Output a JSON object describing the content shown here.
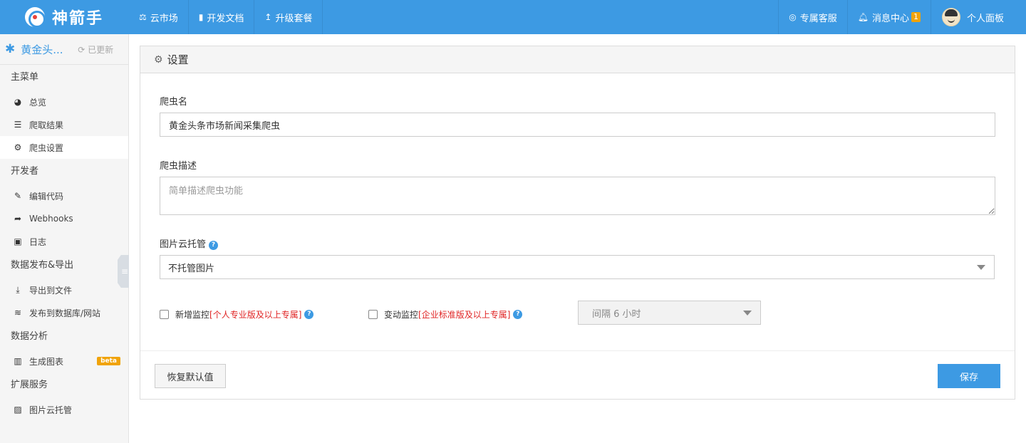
{
  "topbar": {
    "logo": "神箭手",
    "nav_left": [
      {
        "label": "云市场",
        "icon": "scale-icon"
      },
      {
        "label": "开发文档",
        "icon": "book-icon"
      },
      {
        "label": "升级套餐",
        "icon": "upgrade-arrow-icon"
      }
    ],
    "support": "专属客服",
    "messages": "消息中心",
    "messages_count": "1",
    "profile": "个人面板"
  },
  "sidebar": {
    "crawler_name": "黄金头...",
    "updated": "已更新",
    "sections": [
      {
        "title": "主菜单",
        "items": [
          {
            "label": "总览",
            "icon": "dashboard-icon"
          },
          {
            "label": "爬取结果",
            "icon": "list-icon"
          },
          {
            "label": "爬虫设置",
            "icon": "gear-icon"
          }
        ]
      },
      {
        "title": "开发者",
        "items": [
          {
            "label": "编辑代码",
            "icon": "edit-icon"
          },
          {
            "label": "Webhooks",
            "icon": "share-icon"
          },
          {
            "label": "日志",
            "icon": "calendar-icon"
          }
        ]
      },
      {
        "title": "数据发布&导出",
        "items": [
          {
            "label": "导出到文件",
            "icon": "download-icon"
          },
          {
            "label": "发布到数据库/网站",
            "icon": "database-icon"
          }
        ]
      },
      {
        "title": "数据分析",
        "items": [
          {
            "label": "生成图表",
            "icon": "bar-chart-icon",
            "badge": "beta"
          }
        ]
      },
      {
        "title": "扩展服务",
        "items": [
          {
            "label": "图片云托管",
            "icon": "image-icon"
          }
        ]
      }
    ]
  },
  "settings": {
    "title": "设置",
    "name_label": "爬虫名",
    "name_value": "黄金头条市场新闻采集爬虫",
    "desc_label": "爬虫描述",
    "desc_placeholder": "简单描述爬虫功能",
    "image_label": "图片云托管",
    "image_value": "不托管图片",
    "monitor_new_label": "新增监控",
    "monitor_new_note": "[个人专业版及以上专属]",
    "monitor_change_label": "变动监控",
    "monitor_change_note": "[企业标准版及以上专属]",
    "interval_value": "间隔 6 小时",
    "reset_button": "恢复默认值",
    "save_button": "保存"
  },
  "colors": {
    "primary": "#3d9ae3",
    "badge": "#f0a30a",
    "warning_text": "#e02424"
  }
}
